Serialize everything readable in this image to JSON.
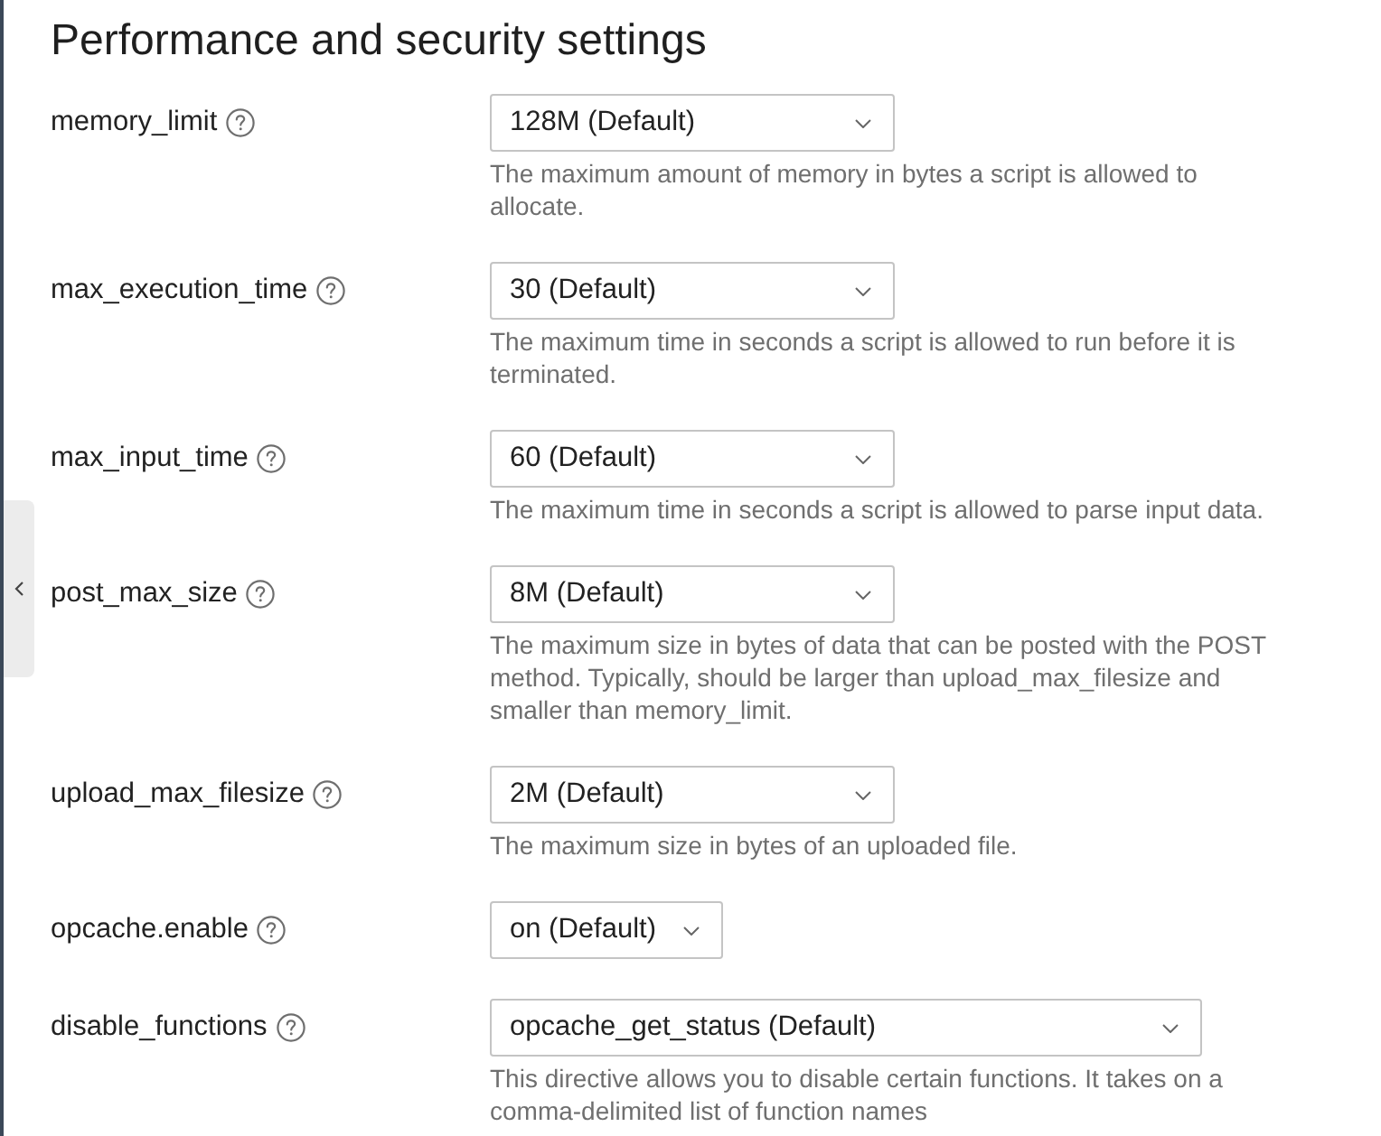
{
  "title": "Performance and security settings",
  "settings": [
    {
      "name": "memory_limit",
      "value": "128M (Default)",
      "kind": "standard",
      "description": "The maximum amount of memory in bytes a script is allowed to allocate."
    },
    {
      "name": "max_execution_time",
      "value": "30 (Default)",
      "kind": "standard",
      "description": "The maximum time in seconds a script is allowed to run before it is terminated."
    },
    {
      "name": "max_input_time",
      "value": "60 (Default)",
      "kind": "standard",
      "description": "The maximum time in seconds a script is allowed to parse input data."
    },
    {
      "name": "post_max_size",
      "value": "8M (Default)",
      "kind": "standard",
      "description": "The maximum size in bytes of data that can be posted with the POST method. Typically, should be larger than upload_max_filesize and smaller than memory_limit."
    },
    {
      "name": "upload_max_filesize",
      "value": "2M (Default)",
      "kind": "standard",
      "description": "The maximum size in bytes of an uploaded file."
    },
    {
      "name": "opcache.enable",
      "value": "on (Default)",
      "kind": "toggle"
    },
    {
      "name": "disable_functions",
      "value": "opcache_get_status (Default)",
      "kind": "list",
      "description": "This directive allows you to disable certain functions. It takes on a comma-delimited list of function names"
    }
  ]
}
